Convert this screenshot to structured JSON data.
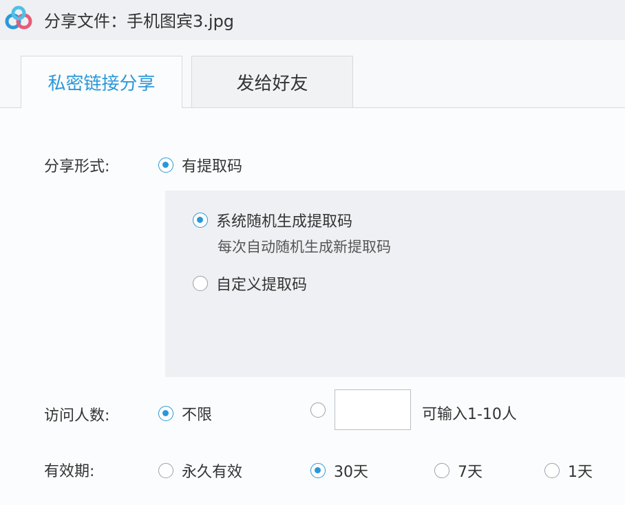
{
  "window": {
    "title": "分享文件：手机图宾3.jpg"
  },
  "tabs": [
    {
      "label": "私密链接分享",
      "active": true
    },
    {
      "label": "发给好友",
      "active": false
    }
  ],
  "share_form": {
    "label": "分享形式:",
    "option": {
      "label": "有提取码",
      "checked": true
    },
    "code_options": [
      {
        "label": "系统随机生成提取码",
        "note": "每次自动随机生成新提取码",
        "checked": true
      },
      {
        "label": "自定义提取码",
        "checked": false
      }
    ]
  },
  "visitors": {
    "label": "访问人数:",
    "unlimited": {
      "label": "不限",
      "checked": true
    },
    "custom": {
      "checked": false,
      "value": "",
      "hint": "可输入1-10人"
    }
  },
  "validity": {
    "label": "有效期:",
    "options": [
      {
        "label": "永久有效",
        "checked": false
      },
      {
        "label": "30天",
        "checked": true
      },
      {
        "label": "7天",
        "checked": false
      },
      {
        "label": "1天",
        "checked": false
      }
    ]
  },
  "colors": {
    "accent": "#2a98d8",
    "logo_blue": "#2a98d8",
    "logo_pink": "#e85a7a"
  }
}
